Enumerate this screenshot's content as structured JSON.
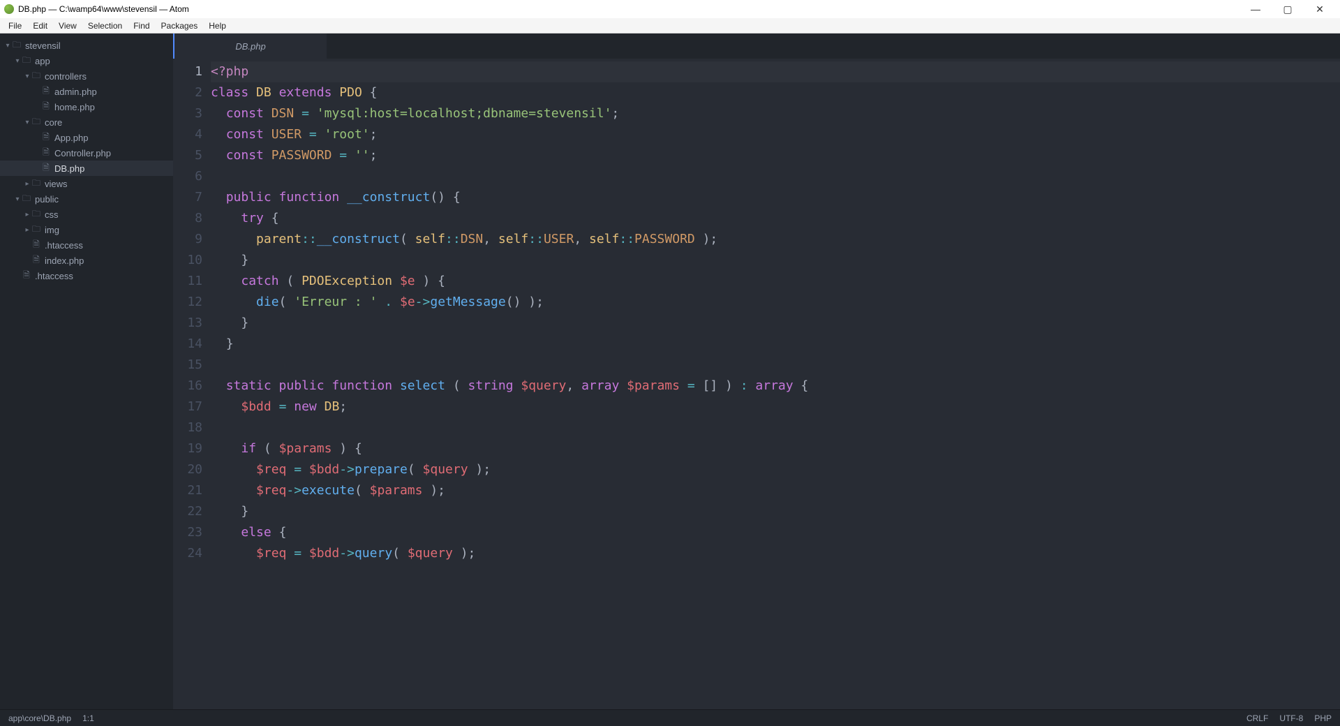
{
  "window": {
    "title": "DB.php — C:\\wamp64\\www\\stevensil — Atom"
  },
  "menu": [
    "File",
    "Edit",
    "View",
    "Selection",
    "Find",
    "Packages",
    "Help"
  ],
  "tree": [
    {
      "depth": 0,
      "type": "folder",
      "expand": "down",
      "label": "stevensil"
    },
    {
      "depth": 1,
      "type": "folder",
      "expand": "down",
      "label": "app"
    },
    {
      "depth": 2,
      "type": "folder",
      "expand": "down",
      "label": "controllers"
    },
    {
      "depth": 3,
      "type": "file",
      "expand": "",
      "label": "admin.php"
    },
    {
      "depth": 3,
      "type": "file",
      "expand": "",
      "label": "home.php"
    },
    {
      "depth": 2,
      "type": "folder",
      "expand": "down",
      "label": "core"
    },
    {
      "depth": 3,
      "type": "file",
      "expand": "",
      "label": "App.php"
    },
    {
      "depth": 3,
      "type": "file",
      "expand": "",
      "label": "Controller.php"
    },
    {
      "depth": 3,
      "type": "file",
      "expand": "",
      "label": "DB.php",
      "selected": true
    },
    {
      "depth": 2,
      "type": "folder",
      "expand": "right",
      "label": "views"
    },
    {
      "depth": 1,
      "type": "folder",
      "expand": "down",
      "label": "public"
    },
    {
      "depth": 2,
      "type": "folder",
      "expand": "right",
      "label": "css"
    },
    {
      "depth": 2,
      "type": "folder",
      "expand": "right",
      "label": "img"
    },
    {
      "depth": 2,
      "type": "file",
      "expand": "",
      "label": ".htaccess"
    },
    {
      "depth": 2,
      "type": "file",
      "expand": "",
      "label": "index.php"
    },
    {
      "depth": 1,
      "type": "file",
      "expand": "",
      "label": ".htaccess"
    }
  ],
  "tab": {
    "label": "DB.php"
  },
  "code_lines": [
    [
      [
        "tok-php",
        "<?php"
      ]
    ],
    [
      [
        "tok-kw",
        "class "
      ],
      [
        "tok-cls",
        "DB"
      ],
      [
        "tok-punc",
        " "
      ],
      [
        "tok-kw",
        "extends "
      ],
      [
        "tok-cls",
        "PDO"
      ],
      [
        "tok-punc",
        " "
      ],
      [
        "tok-brace",
        "{"
      ]
    ],
    [
      [
        "tok-punc",
        "  "
      ],
      [
        "tok-kw",
        "const "
      ],
      [
        "tok-const",
        "DSN"
      ],
      [
        "tok-punc",
        " "
      ],
      [
        "tok-op",
        "="
      ],
      [
        "tok-punc",
        " "
      ],
      [
        "tok-str",
        "'mysql:host=localhost;dbname=stevensil'"
      ],
      [
        "tok-punc",
        ";"
      ]
    ],
    [
      [
        "tok-punc",
        "  "
      ],
      [
        "tok-kw",
        "const "
      ],
      [
        "tok-const",
        "USER"
      ],
      [
        "tok-punc",
        " "
      ],
      [
        "tok-op",
        "="
      ],
      [
        "tok-punc",
        " "
      ],
      [
        "tok-str",
        "'root'"
      ],
      [
        "tok-punc",
        ";"
      ]
    ],
    [
      [
        "tok-punc",
        "  "
      ],
      [
        "tok-kw",
        "const "
      ],
      [
        "tok-const",
        "PASSWORD"
      ],
      [
        "tok-punc",
        " "
      ],
      [
        "tok-op",
        "="
      ],
      [
        "tok-punc",
        " "
      ],
      [
        "tok-str",
        "''"
      ],
      [
        "tok-punc",
        ";"
      ]
    ],
    [
      [
        "tok-punc",
        ""
      ]
    ],
    [
      [
        "tok-punc",
        "  "
      ],
      [
        "tok-kw",
        "public "
      ],
      [
        "tok-kw",
        "function "
      ],
      [
        "tok-fn",
        "__construct"
      ],
      [
        "tok-punc",
        "() "
      ],
      [
        "tok-brace",
        "{"
      ]
    ],
    [
      [
        "tok-punc",
        "    "
      ],
      [
        "tok-kw",
        "try"
      ],
      [
        "tok-punc",
        " "
      ],
      [
        "tok-brace",
        "{"
      ]
    ],
    [
      [
        "tok-punc",
        "      "
      ],
      [
        "tok-self",
        "parent"
      ],
      [
        "tok-op",
        "::"
      ],
      [
        "tok-fn",
        "__construct"
      ],
      [
        "tok-punc",
        "( "
      ],
      [
        "tok-self",
        "self"
      ],
      [
        "tok-op",
        "::"
      ],
      [
        "tok-const",
        "DSN"
      ],
      [
        "tok-punc",
        ", "
      ],
      [
        "tok-self",
        "self"
      ],
      [
        "tok-op",
        "::"
      ],
      [
        "tok-const",
        "USER"
      ],
      [
        "tok-punc",
        ", "
      ],
      [
        "tok-self",
        "self"
      ],
      [
        "tok-op",
        "::"
      ],
      [
        "tok-const",
        "PASSWORD"
      ],
      [
        "tok-punc",
        " );"
      ]
    ],
    [
      [
        "tok-punc",
        "    "
      ],
      [
        "tok-brace",
        "}"
      ]
    ],
    [
      [
        "tok-punc",
        "    "
      ],
      [
        "tok-kw",
        "catch"
      ],
      [
        "tok-punc",
        " ( "
      ],
      [
        "tok-cls",
        "PDOException"
      ],
      [
        "tok-punc",
        " "
      ],
      [
        "tok-var",
        "$e"
      ],
      [
        "tok-punc",
        " ) "
      ],
      [
        "tok-brace",
        "{"
      ]
    ],
    [
      [
        "tok-punc",
        "      "
      ],
      [
        "tok-fn",
        "die"
      ],
      [
        "tok-punc",
        "( "
      ],
      [
        "tok-str",
        "'Erreur : '"
      ],
      [
        "tok-punc",
        " "
      ],
      [
        "tok-op",
        "."
      ],
      [
        "tok-punc",
        " "
      ],
      [
        "tok-var",
        "$e"
      ],
      [
        "tok-op",
        "->"
      ],
      [
        "tok-fn",
        "getMessage"
      ],
      [
        "tok-punc",
        "() );"
      ]
    ],
    [
      [
        "tok-punc",
        "    "
      ],
      [
        "tok-brace",
        "}"
      ]
    ],
    [
      [
        "tok-punc",
        "  "
      ],
      [
        "tok-brace",
        "}"
      ]
    ],
    [
      [
        "tok-punc",
        ""
      ]
    ],
    [
      [
        "tok-punc",
        "  "
      ],
      [
        "tok-kw",
        "static "
      ],
      [
        "tok-kw",
        "public "
      ],
      [
        "tok-kw",
        "function "
      ],
      [
        "tok-fn",
        "select"
      ],
      [
        "tok-punc",
        " ( "
      ],
      [
        "tok-type",
        "string"
      ],
      [
        "tok-punc",
        " "
      ],
      [
        "tok-var",
        "$query"
      ],
      [
        "tok-punc",
        ", "
      ],
      [
        "tok-type",
        "array"
      ],
      [
        "tok-punc",
        " "
      ],
      [
        "tok-var",
        "$params"
      ],
      [
        "tok-punc",
        " "
      ],
      [
        "tok-op",
        "="
      ],
      [
        "tok-punc",
        " [] ) "
      ],
      [
        "tok-op",
        ":"
      ],
      [
        "tok-punc",
        " "
      ],
      [
        "tok-type",
        "array"
      ],
      [
        "tok-punc",
        " "
      ],
      [
        "tok-brace",
        "{"
      ]
    ],
    [
      [
        "tok-punc",
        "    "
      ],
      [
        "tok-var",
        "$bdd"
      ],
      [
        "tok-punc",
        " "
      ],
      [
        "tok-op",
        "="
      ],
      [
        "tok-punc",
        " "
      ],
      [
        "tok-kw",
        "new "
      ],
      [
        "tok-cls",
        "DB"
      ],
      [
        "tok-punc",
        ";"
      ]
    ],
    [
      [
        "tok-punc",
        ""
      ]
    ],
    [
      [
        "tok-punc",
        "    "
      ],
      [
        "tok-kw",
        "if"
      ],
      [
        "tok-punc",
        " ( "
      ],
      [
        "tok-var",
        "$params"
      ],
      [
        "tok-punc",
        " ) "
      ],
      [
        "tok-brace",
        "{"
      ]
    ],
    [
      [
        "tok-punc",
        "      "
      ],
      [
        "tok-var",
        "$req"
      ],
      [
        "tok-punc",
        " "
      ],
      [
        "tok-op",
        "="
      ],
      [
        "tok-punc",
        " "
      ],
      [
        "tok-var",
        "$bdd"
      ],
      [
        "tok-op",
        "->"
      ],
      [
        "tok-fn",
        "prepare"
      ],
      [
        "tok-punc",
        "( "
      ],
      [
        "tok-var",
        "$query"
      ],
      [
        "tok-punc",
        " );"
      ]
    ],
    [
      [
        "tok-punc",
        "      "
      ],
      [
        "tok-var",
        "$req"
      ],
      [
        "tok-op",
        "->"
      ],
      [
        "tok-fn",
        "execute"
      ],
      [
        "tok-punc",
        "( "
      ],
      [
        "tok-var",
        "$params"
      ],
      [
        "tok-punc",
        " );"
      ]
    ],
    [
      [
        "tok-punc",
        "    "
      ],
      [
        "tok-brace",
        "}"
      ]
    ],
    [
      [
        "tok-punc",
        "    "
      ],
      [
        "tok-kw",
        "else"
      ],
      [
        "tok-punc",
        " "
      ],
      [
        "tok-brace",
        "{"
      ]
    ],
    [
      [
        "tok-punc",
        "      "
      ],
      [
        "tok-var",
        "$req"
      ],
      [
        "tok-punc",
        " "
      ],
      [
        "tok-op",
        "="
      ],
      [
        "tok-punc",
        " "
      ],
      [
        "tok-var",
        "$bdd"
      ],
      [
        "tok-op",
        "->"
      ],
      [
        "tok-fn",
        "query"
      ],
      [
        "tok-punc",
        "( "
      ],
      [
        "tok-var",
        "$query"
      ],
      [
        "tok-punc",
        " );"
      ]
    ]
  ],
  "current_line_index": 0,
  "status": {
    "path": "app\\core\\DB.php",
    "cursor": "1:1",
    "eol": "CRLF",
    "encoding": "UTF-8",
    "language": "PHP"
  }
}
